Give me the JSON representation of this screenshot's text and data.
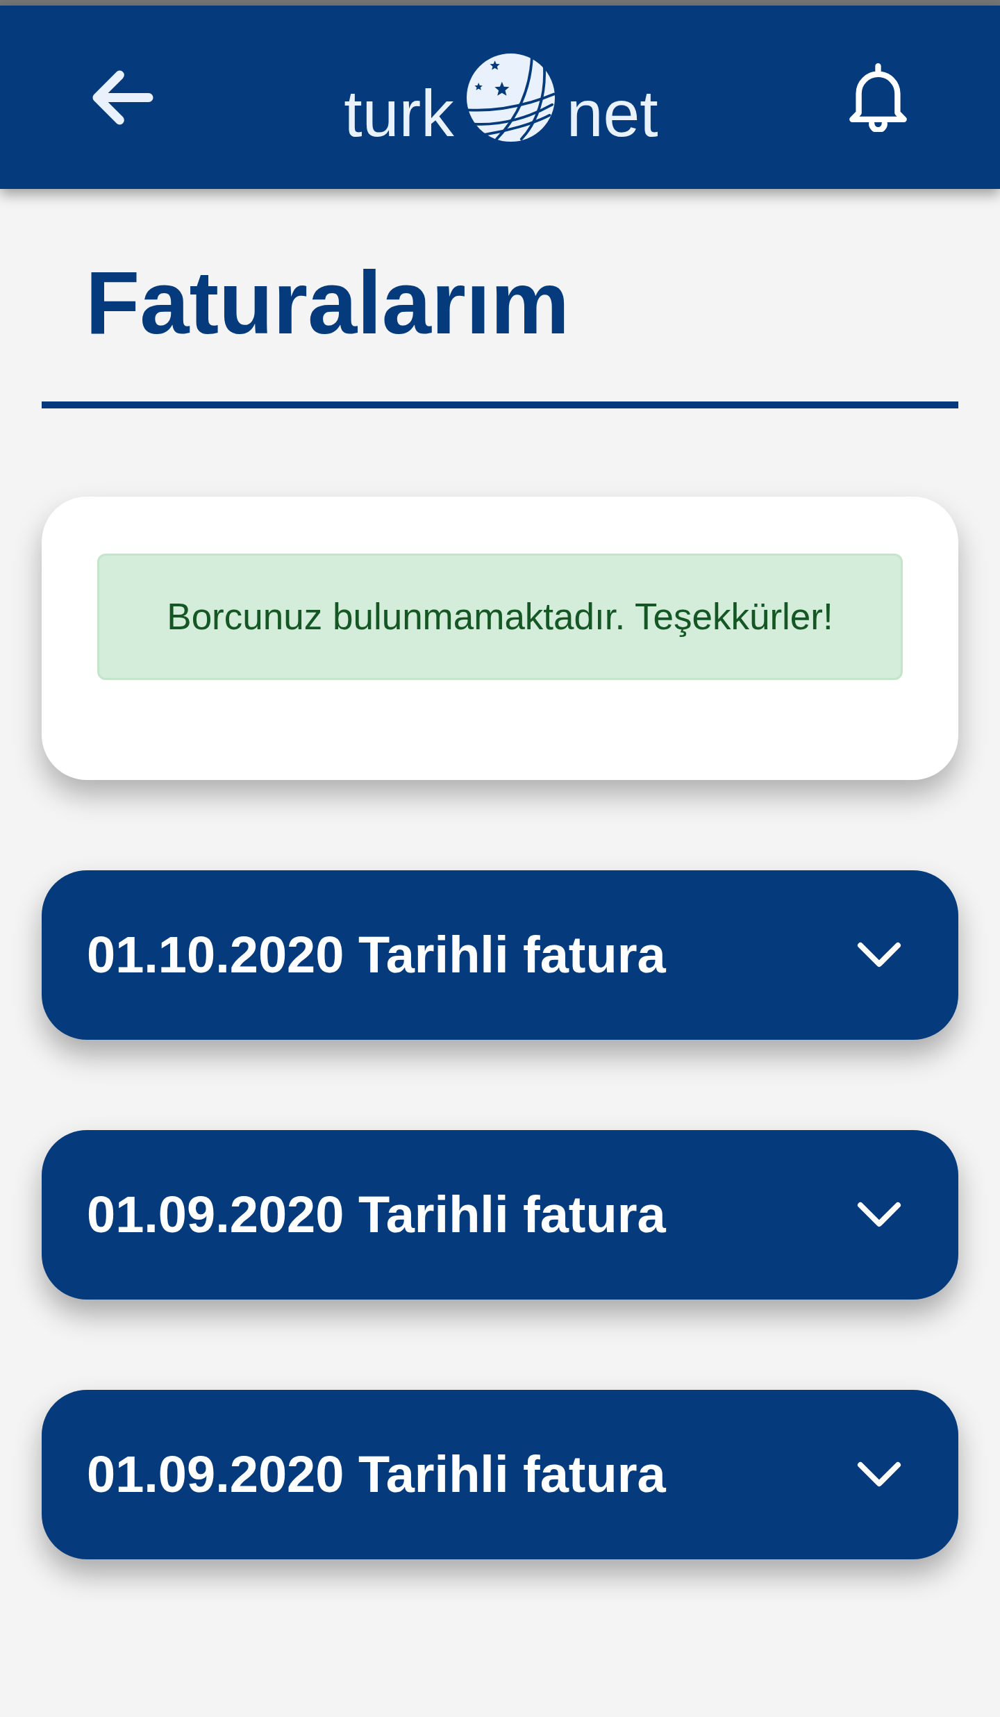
{
  "header": {
    "logo": {
      "text_left": "turk",
      "text_right": "net"
    }
  },
  "page_title": "Faturalarım",
  "notice": {
    "text": "Borcunuz bulunmamaktadır. Teşekkürler!"
  },
  "invoices": [
    {
      "label": "01.10.2020 Tarihli fatura",
      "expanded": false
    },
    {
      "label": "01.09.2020 Tarihli fatura",
      "expanded": false
    },
    {
      "label": "01.09.2020 Tarihli fatura",
      "expanded": false
    }
  ]
}
